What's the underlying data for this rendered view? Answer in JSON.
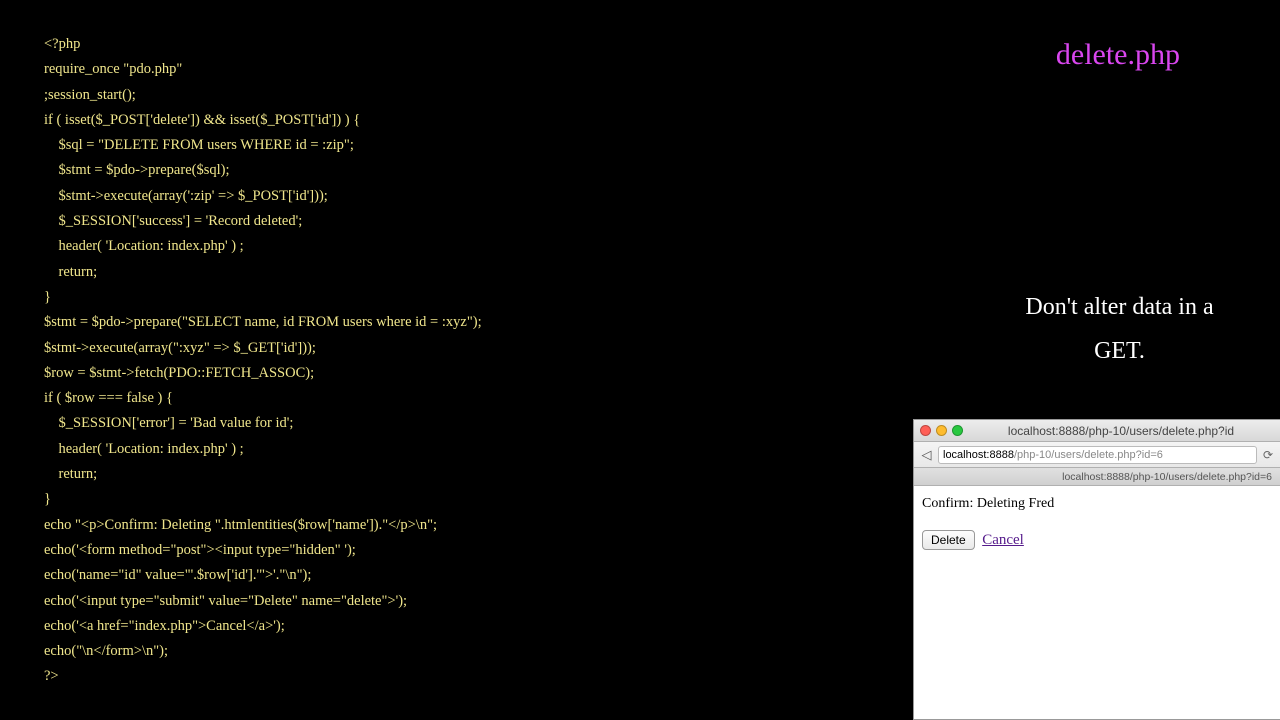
{
  "file_title": "delete.php",
  "caption": "Don't alter data in a GET.",
  "code": "<?php\nrequire_once \"pdo.php\"\n;session_start();\nif ( isset($_POST['delete']) && isset($_POST['id']) ) {\n    $sql = \"DELETE FROM users WHERE id = :zip\";\n    $stmt = $pdo->prepare($sql);\n    $stmt->execute(array(':zip' => $_POST['id']));\n    $_SESSION['success'] = 'Record deleted';\n    header( 'Location: index.php' ) ;\n    return;\n}\n$stmt = $pdo->prepare(\"SELECT name, id FROM users where id = :xyz\");\n$stmt->execute(array(\":xyz\" => $_GET['id']));\n$row = $stmt->fetch(PDO::FETCH_ASSOC);\nif ( $row === false ) {\n    $_SESSION['error'] = 'Bad value for id';\n    header( 'Location: index.php' ) ;\n    return;\n}\necho \"<p>Confirm: Deleting \".htmlentities($row['name']).\"</p>\\n\";\necho('<form method=\"post\"><input type=\"hidden\" ');\necho('name=\"id\" value=\"'.$row['id'].'\">'.\"\\n\");\necho('<input type=\"submit\" value=\"Delete\" name=\"delete\">');\necho('<a href=\"index.php\">Cancel</a>');\necho(\"\\n</form>\\n\");\n?>",
  "browser": {
    "title": "localhost:8888/php-10/users/delete.php?id",
    "url_bold": "localhost:8888",
    "url_dim": "/php-10/users/delete.php?id=6",
    "tab": "localhost:8888/php-10/users/delete.php?id=6",
    "confirm_text": "Confirm: Deleting Fred",
    "delete_label": "Delete",
    "cancel_label": "Cancel"
  }
}
